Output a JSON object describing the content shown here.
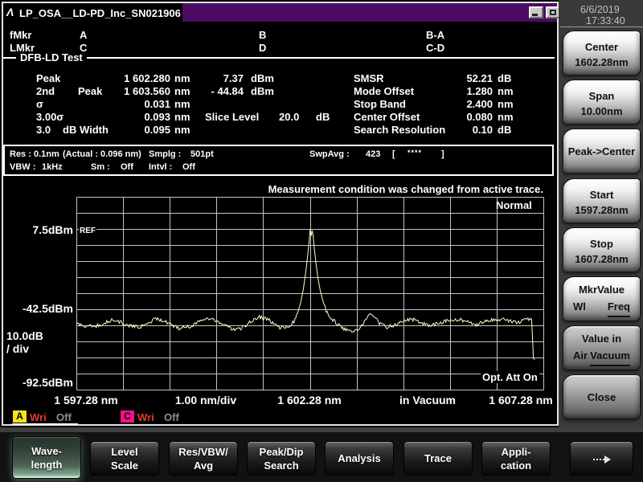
{
  "window": {
    "title": "LP_OSA__LD-PD_Inc_SN021906",
    "logo": "Λ"
  },
  "clock": {
    "date": "6/6/2019",
    "time": "17:33:40"
  },
  "markers": {
    "fmkr": "fMkr",
    "lmkr": "LMkr",
    "a": "A",
    "b": "B",
    "ba": "B-A",
    "c": "C",
    "d": "D",
    "cd": "C-D"
  },
  "analysis": {
    "title": "DFB-LD Test",
    "left_rows": [
      {
        "name": "Peak",
        "name2": "",
        "wavelength": "1 602.280",
        "wl_unit": "nm",
        "power": "7.37",
        "pw_unit": "dBm",
        "extra_label": "",
        "extra_value": "",
        "extra_unit": ""
      },
      {
        "name": "2nd",
        "name2": "Peak",
        "wavelength": "1 603.560",
        "wl_unit": "nm",
        "power": "- 44.84",
        "pw_unit": "dBm",
        "extra_label": "",
        "extra_value": "",
        "extra_unit": ""
      },
      {
        "name": "σ",
        "name2": "",
        "wavelength": "0.031",
        "wl_unit": "nm",
        "power": "",
        "pw_unit": "",
        "extra_label": "",
        "extra_value": "",
        "extra_unit": ""
      },
      {
        "name": "3.00σ",
        "name2": "",
        "wavelength": "0.093",
        "wl_unit": "nm",
        "power": "",
        "pw_unit": "",
        "extra_label": "Slice Level",
        "extra_value": "20.0",
        "extra_unit": "dB"
      },
      {
        "name": "3.0",
        "name2": "dB Width",
        "wavelength": "0.095",
        "wl_unit": "nm",
        "power": "",
        "pw_unit": "",
        "extra_label": "",
        "extra_value": "",
        "extra_unit": ""
      }
    ],
    "right_rows": [
      {
        "label": "SMSR",
        "value": "52.21",
        "unit": "dB"
      },
      {
        "label": "Mode Offset",
        "value": "1.280",
        "unit": "nm"
      },
      {
        "label": "Stop Band",
        "value": "2.400",
        "unit": "nm"
      },
      {
        "label": "Center Offset",
        "value": "0.080",
        "unit": "nm"
      },
      {
        "label": "Search Resolution",
        "value": "0.10",
        "unit": "dB"
      }
    ]
  },
  "acquisition": {
    "res_label": "Res :",
    "res": "0.1nm",
    "actual": "(Actual : 0.096 nm)",
    "smplg_label": "Smplg :",
    "smplg": "501pt",
    "swpavg_label": "SwpAvg :",
    "swpavg_value": "423",
    "bracket_open": "[",
    "stars": "****",
    "bracket_close": "]",
    "vbw_label": "VBW :",
    "vbw": "1kHz",
    "sm_label": "Sm :",
    "sm": "Off",
    "intvl_label": "Intvl :",
    "intvl": "Off"
  },
  "chart_data": {
    "type": "line",
    "message": "Measurement condition was changed from active trace.",
    "trace_mode": "Normal",
    "ref_label": "REF",
    "opt_att": "Opt. Att On",
    "x_axis": {
      "start_label": "1 597.28 nm",
      "div_label": "1.00 nm/div",
      "center_label": "1 602.28 nm",
      "medium_label": "in Vacuum",
      "stop_label": "1 607.28 nm",
      "start_nm": 1597.28,
      "stop_nm": 1607.28,
      "nm_per_div": 1.0
    },
    "y_axis": {
      "ref_line_label": "7.5dBm",
      "mid_label": "-42.5dBm",
      "scale_label_1": "10.0dB",
      "scale_label_2": "/ div",
      "bottom_label": "-92.5dBm",
      "ref_dbm": 7.5,
      "top_dbm": 27.5,
      "bottom_dbm": -92.5,
      "db_per_div": 10
    },
    "grid": {
      "cols": 10,
      "rows": 12
    },
    "noise_jitter_db": 2.2,
    "series": [
      {
        "name": "A",
        "color": "#ffffc8",
        "points": [
          [
            1597.28,
            -51.5
          ],
          [
            1597.45,
            -52.6
          ],
          [
            1597.68,
            -52.9
          ],
          [
            1597.88,
            -50.6
          ],
          [
            1598.05,
            -48.9
          ],
          [
            1598.19,
            -50.1
          ],
          [
            1598.4,
            -52.6
          ],
          [
            1598.61,
            -53.4
          ],
          [
            1598.79,
            -51.9
          ],
          [
            1598.97,
            -47.6
          ],
          [
            1599.17,
            -50.1
          ],
          [
            1599.47,
            -54
          ],
          [
            1599.72,
            -52.9
          ],
          [
            1599.95,
            -48.6
          ],
          [
            1600.15,
            -48.2
          ],
          [
            1600.34,
            -51.1
          ],
          [
            1600.64,
            -54.9
          ],
          [
            1600.81,
            -53.9
          ],
          [
            1600.98,
            -50.4
          ],
          [
            1601.19,
            -46.9
          ],
          [
            1601.41,
            -49.2
          ],
          [
            1601.63,
            -54.1
          ],
          [
            1601.81,
            -52.8
          ],
          [
            1601.93,
            -50
          ],
          [
            1602.01,
            -45
          ],
          [
            1602.08,
            -37.5
          ],
          [
            1602.13,
            -30
          ],
          [
            1602.18,
            -20
          ],
          [
            1602.22,
            -10
          ],
          [
            1602.25,
            -2
          ],
          [
            1602.27,
            5
          ],
          [
            1602.28,
            7.37
          ],
          [
            1602.3,
            3.5
          ],
          [
            1602.32,
            6.8
          ],
          [
            1602.34,
            4
          ],
          [
            1602.37,
            -5
          ],
          [
            1602.4,
            -13
          ],
          [
            1602.44,
            -22
          ],
          [
            1602.49,
            -30
          ],
          [
            1602.55,
            -37
          ],
          [
            1602.62,
            -43
          ],
          [
            1602.72,
            -47.5
          ],
          [
            1602.85,
            -51
          ],
          [
            1603,
            -54.5
          ],
          [
            1603.15,
            -56
          ],
          [
            1603.28,
            -55.3
          ],
          [
            1603.4,
            -52.3
          ],
          [
            1603.48,
            -48.6
          ],
          [
            1603.52,
            -46.2
          ],
          [
            1603.56,
            -44.9
          ],
          [
            1603.61,
            -46
          ],
          [
            1603.66,
            -47.3
          ],
          [
            1603.76,
            -50.8
          ],
          [
            1603.92,
            -53.4
          ],
          [
            1604.1,
            -52
          ],
          [
            1604.3,
            -49.4
          ],
          [
            1604.48,
            -48.6
          ],
          [
            1604.65,
            -50.6
          ],
          [
            1604.86,
            -52.6
          ],
          [
            1605.03,
            -51
          ],
          [
            1605.25,
            -48.9
          ],
          [
            1605.48,
            -48.6
          ],
          [
            1605.68,
            -50.1
          ],
          [
            1605.85,
            -52.1
          ],
          [
            1606.03,
            -49.6
          ],
          [
            1606.23,
            -48.6
          ],
          [
            1606.4,
            -48.4
          ],
          [
            1606.57,
            -49.6
          ],
          [
            1606.74,
            -50.6
          ],
          [
            1606.84,
            -49.1
          ],
          [
            1606.94,
            -48.6
          ],
          [
            1607.02,
            -48.9
          ],
          [
            1607.06,
            -73
          ],
          [
            1607.09,
            -73.5
          ]
        ]
      }
    ]
  },
  "trace_status": [
    {
      "letter": "A",
      "color": "#f0e41c",
      "write": "Wri",
      "state": "Off",
      "active": true
    },
    {
      "letter": "C",
      "color": "#ee1289",
      "write": "Wri",
      "state": "Off",
      "active": false
    }
  ],
  "sidebar": {
    "buttons": [
      {
        "line1": "Center",
        "line2": "1602.28nm",
        "style": "light"
      },
      {
        "line1": "Span",
        "line2": "10.00nm",
        "style": "light"
      },
      {
        "line1": "Peak->Center",
        "line2": "",
        "style": "light"
      },
      {
        "line1": "Start",
        "line2": "1597.28nm",
        "style": "light"
      },
      {
        "line1": "Stop",
        "line2": "1607.28nm",
        "style": "light"
      },
      {
        "line1": "MkrValue",
        "opt_a": "Wl",
        "opt_b": "Freq",
        "selected_opt": "b",
        "style": "light"
      },
      {
        "line1": "Value in",
        "opt_a": "Air",
        "opt_b": "Vacuum",
        "selected_opt": "b",
        "style": "dark"
      },
      {
        "line1": "Close",
        "line2": "",
        "style": "dark"
      }
    ]
  },
  "menu": {
    "items": [
      {
        "line1": "Wave-",
        "line2": "length",
        "selected": true
      },
      {
        "line1": "Level",
        "line2": "Scale",
        "selected": false
      },
      {
        "line1": "Res/VBW/",
        "line2": "Avg",
        "selected": false
      },
      {
        "line1": "Peak/Dip",
        "line2": "Search",
        "selected": false
      },
      {
        "line1": "Analysis",
        "line2": "",
        "selected": false
      },
      {
        "line1": "Trace",
        "line2": "",
        "selected": false
      },
      {
        "line1": "Appli-",
        "line2": "cation",
        "selected": false
      },
      {
        "line1": "→",
        "line2": "",
        "selected": false,
        "arrow": true
      }
    ]
  }
}
